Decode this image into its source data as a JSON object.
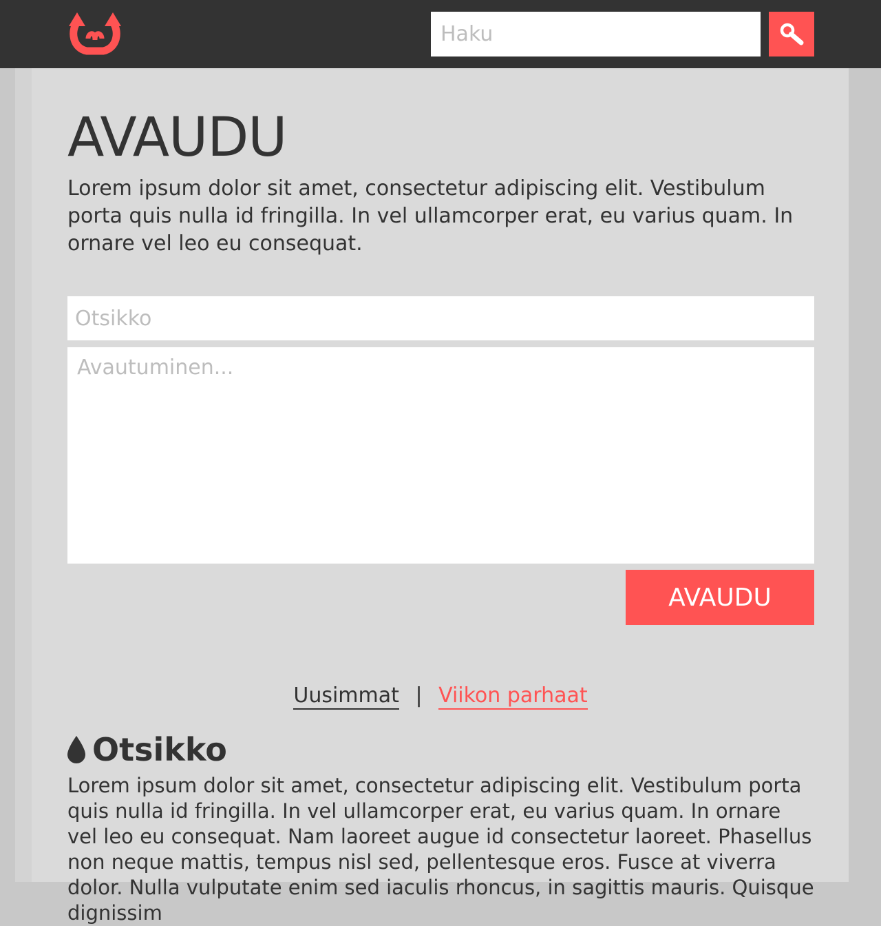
{
  "header": {
    "logo_icon": "double-arrow-horns-logo",
    "search": {
      "placeholder": "Haku",
      "value": ""
    },
    "search_button_icon": "search-icon"
  },
  "main": {
    "title": "AVAUDU",
    "intro": "Lorem ipsum dolor sit amet, consectetur adipiscing elit. Vestibulum porta quis nulla id fringilla. In vel ullamcorper erat, eu varius quam. In ornare vel leo eu consequat.",
    "form": {
      "title_placeholder": "Otsikko",
      "title_value": "",
      "body_placeholder": "Avautuminen...",
      "body_value": "",
      "submit_label": "AVAUDU"
    },
    "sort_tabs": [
      {
        "label": "Uusimmat",
        "active": false
      },
      {
        "label": "Viikon parhaat",
        "active": true
      }
    ],
    "sort_separator": "|",
    "posts": [
      {
        "icon": "drop-icon",
        "title": "Otsikko",
        "body": "Lorem ipsum dolor sit amet, consectetur adipiscing elit. Vestibulum porta quis nulla id fringilla. In vel ullamcorper erat, eu varius quam. In ornare vel leo eu consequat. Nam laoreet augue id consectetur laoreet. Phasellus non neque mattis, tempus nisl sed, pellentesque eros. Fusce at viverra dolor. Nulla vulputate enim sed iaculis rhoncus, in sagittis mauris. Quisque dignissim"
      }
    ]
  },
  "colors": {
    "accent": "#ff5353",
    "dark": "#333333",
    "panel": "#dadada",
    "page_bg": "#c8c8c8",
    "placeholder": "#bdbdbd"
  }
}
